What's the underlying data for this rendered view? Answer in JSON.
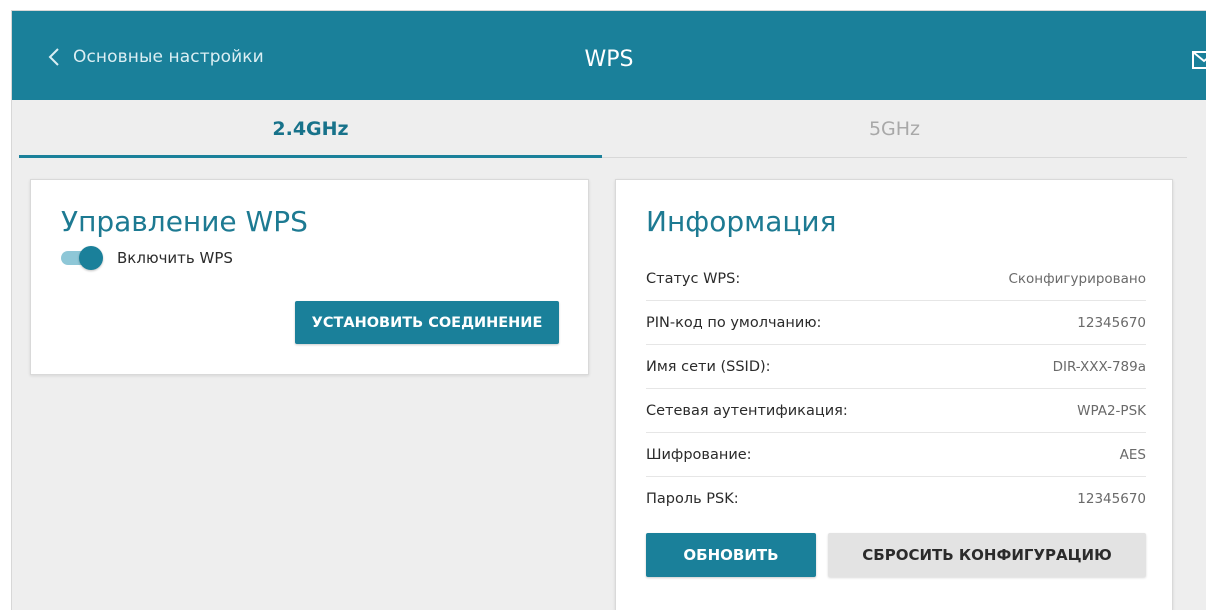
{
  "header": {
    "back_label": "Основные настройки",
    "title": "WPS"
  },
  "tabs": [
    {
      "label": "2.4GHz",
      "active": true
    },
    {
      "label": "5GHz",
      "active": false
    }
  ],
  "wps_control": {
    "title": "Управление WPS",
    "toggle_label": "Включить WPS",
    "toggle_on": true,
    "connect_button": "УСТАНОВИТЬ СОЕДИНЕНИЕ"
  },
  "info": {
    "title": "Информация",
    "rows": [
      {
        "label": "Статус WPS:",
        "value": "Сконфигурировано"
      },
      {
        "label": "PIN-код по умолчанию:",
        "value": "12345670"
      },
      {
        "label": "Имя сети (SSID):",
        "value": "DIR-XXX-789a"
      },
      {
        "label": "Сетевая аутентификация:",
        "value": "WPA2-PSK"
      },
      {
        "label": "Шифрование:",
        "value": "AES"
      },
      {
        "label": "Пароль PSK:",
        "value": "12345670"
      }
    ],
    "refresh_button": "ОБНОВИТЬ",
    "reset_button": "СБРОСИТЬ КОНФИГУРАЦИЮ"
  },
  "colors": {
    "accent": "#1a809a",
    "background": "#eeeeee",
    "active_tab": "#17728a",
    "inactive_tab": "#a8a8a8"
  },
  "icons": {
    "back": "chevron-left-icon",
    "mail": "mail-icon"
  }
}
